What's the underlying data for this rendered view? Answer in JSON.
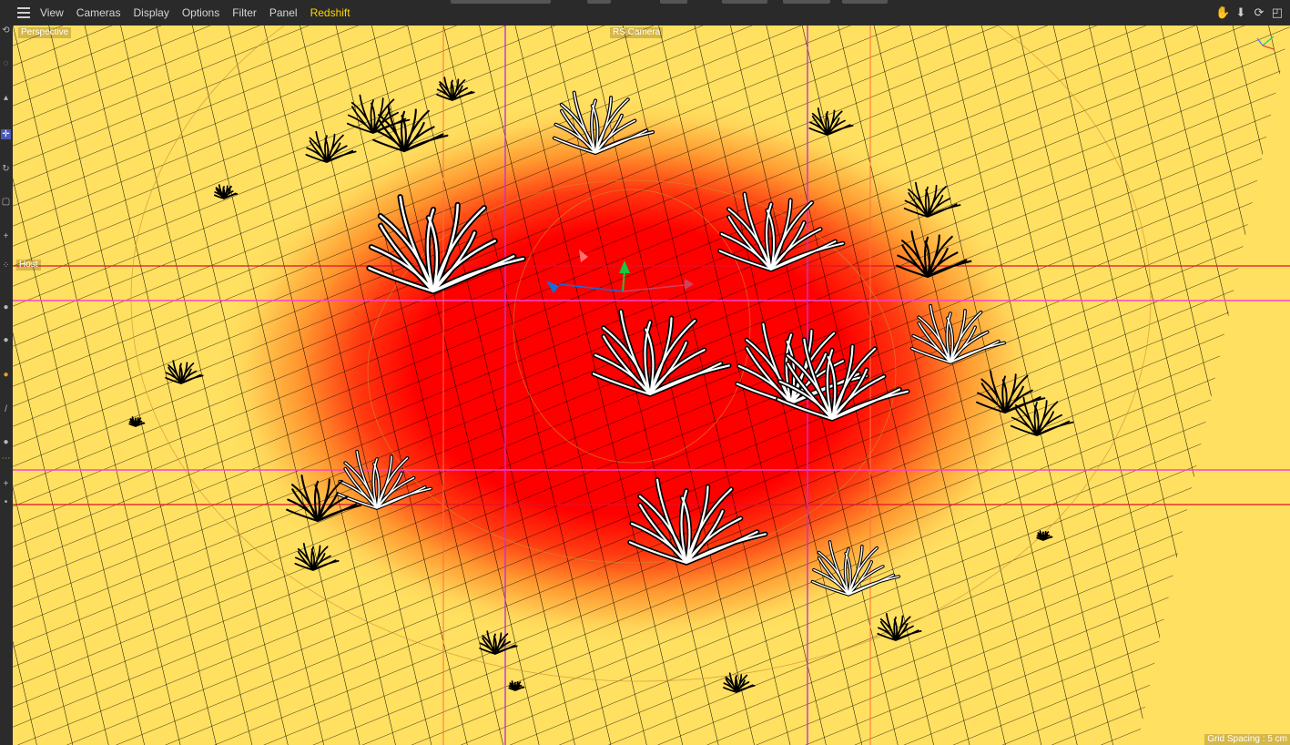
{
  "menu": {
    "items": [
      {
        "label": "View"
      },
      {
        "label": "Cameras"
      },
      {
        "label": "Display"
      },
      {
        "label": "Options"
      },
      {
        "label": "Filter"
      },
      {
        "label": "Panel"
      },
      {
        "label": "Redshift",
        "accent": true
      }
    ]
  },
  "nav_icons": [
    "hand-icon",
    "move-down-icon",
    "rotate-icon",
    "maximize-icon"
  ],
  "viewport": {
    "camera_label": "Perspective",
    "rs_camera_label": "RS Camera",
    "host_label": "Host",
    "grid_spacing": "Grid Spacing : 5 cm"
  },
  "tools": [
    "undo-icon",
    "live-select-icon",
    "select-icon",
    "move-icon",
    "rotate-icon",
    "scale-icon",
    "axis-icon",
    "transform-icon",
    "paint-icon",
    "magnet-icon",
    "brush-icon",
    "sculpt-icon",
    "knife-icon",
    "weld-icon",
    "point-icon",
    "edge-icon"
  ],
  "colors": {
    "ground": "#ffe060",
    "hot": "#ff0000",
    "grid": "#000000",
    "guide_red": "#e0102a",
    "guide_magenta": "#ff40d0",
    "accent": "#ffd400"
  }
}
